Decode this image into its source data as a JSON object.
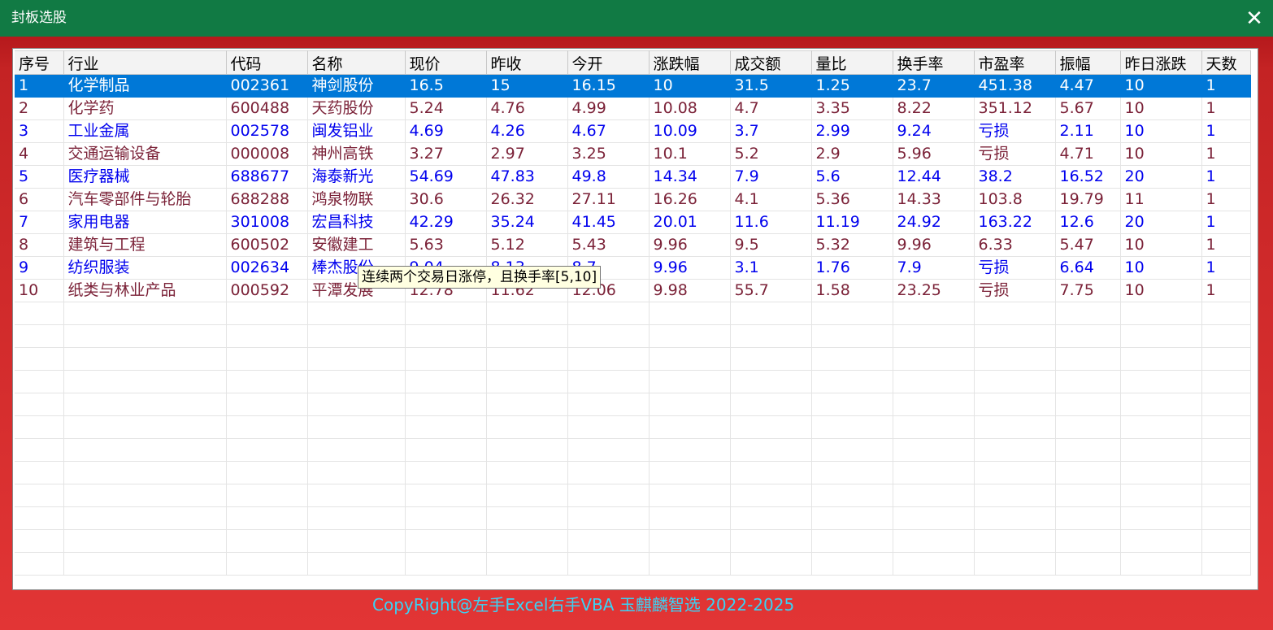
{
  "window": {
    "title": "封板选股",
    "close_glyph": "✕"
  },
  "table": {
    "columns": [
      "序号",
      "行业",
      "代码",
      "名称",
      "现价",
      "昨收",
      "今开",
      "涨跌幅",
      "成交额",
      "量比",
      "换手率",
      "市盈率",
      "振幅",
      "昨日涨跌",
      "天数"
    ],
    "rows": [
      [
        "1",
        "化学制品",
        "002361",
        "神剑股份",
        "16.5",
        "15",
        "16.15",
        "10",
        "31.5",
        "1.25",
        "23.7",
        "451.38",
        "4.47",
        "10",
        "1"
      ],
      [
        "2",
        "化学药",
        "600488",
        "天药股份",
        "5.24",
        "4.76",
        "4.99",
        "10.08",
        "4.7",
        "3.35",
        "8.22",
        "351.12",
        "5.67",
        "10",
        "1"
      ],
      [
        "3",
        "工业金属",
        "002578",
        "闽发铝业",
        "4.69",
        "4.26",
        "4.67",
        "10.09",
        "3.7",
        "2.99",
        "9.24",
        "亏损",
        "2.11",
        "10",
        "1"
      ],
      [
        "4",
        "交通运输设备",
        "000008",
        "神州高铁",
        "3.27",
        "2.97",
        "3.25",
        "10.1",
        "5.2",
        "2.9",
        "5.96",
        "亏损",
        "4.71",
        "10",
        "1"
      ],
      [
        "5",
        "医疗器械",
        "688677",
        "海泰新光",
        "54.69",
        "47.83",
        "49.8",
        "14.34",
        "7.9",
        "5.6",
        "12.44",
        "38.2",
        "16.52",
        "20",
        "1"
      ],
      [
        "6",
        "汽车零部件与轮胎",
        "688288",
        "鸿泉物联",
        "30.6",
        "26.32",
        "27.11",
        "16.26",
        "4.1",
        "5.36",
        "14.33",
        "103.8",
        "19.79",
        "11",
        "1"
      ],
      [
        "7",
        "家用电器",
        "301008",
        "宏昌科技",
        "42.29",
        "35.24",
        "41.45",
        "20.01",
        "11.6",
        "11.19",
        "24.92",
        "163.22",
        "12.6",
        "20",
        "1"
      ],
      [
        "8",
        "建筑与工程",
        "600502",
        "安徽建工",
        "5.63",
        "5.12",
        "5.43",
        "9.96",
        "9.5",
        "5.32",
        "9.96",
        "6.33",
        "5.47",
        "10",
        "1"
      ],
      [
        "9",
        "纺织服装",
        "002634",
        "棒杰股份",
        "9.04",
        "8.13",
        "8.7",
        "9.96",
        "3.1",
        "1.76",
        "7.9",
        "亏损",
        "6.64",
        "10",
        "1"
      ],
      [
        "10",
        "纸类与林业产品",
        "000592",
        "平潭发展",
        "12.78",
        "11.62",
        "12.06",
        "9.98",
        "55.7",
        "1.58",
        "23.25",
        "亏损",
        "7.75",
        "10",
        "1"
      ]
    ],
    "selected_row": 0
  },
  "tooltip": {
    "text": "连续两个交易日涨停，且换手率[5,10]"
  },
  "footer": {
    "copyright": "CopyRight@左手Excel右手VBA 玉麒麟智选  2022-2025"
  },
  "colors": {
    "titlebar": "#117a44",
    "frame": "#e23a3a",
    "selection": "#0078d7",
    "row_odd_text": "#0000ee",
    "row_even_text": "#7b2238",
    "footer_text": "#39d3f5"
  }
}
